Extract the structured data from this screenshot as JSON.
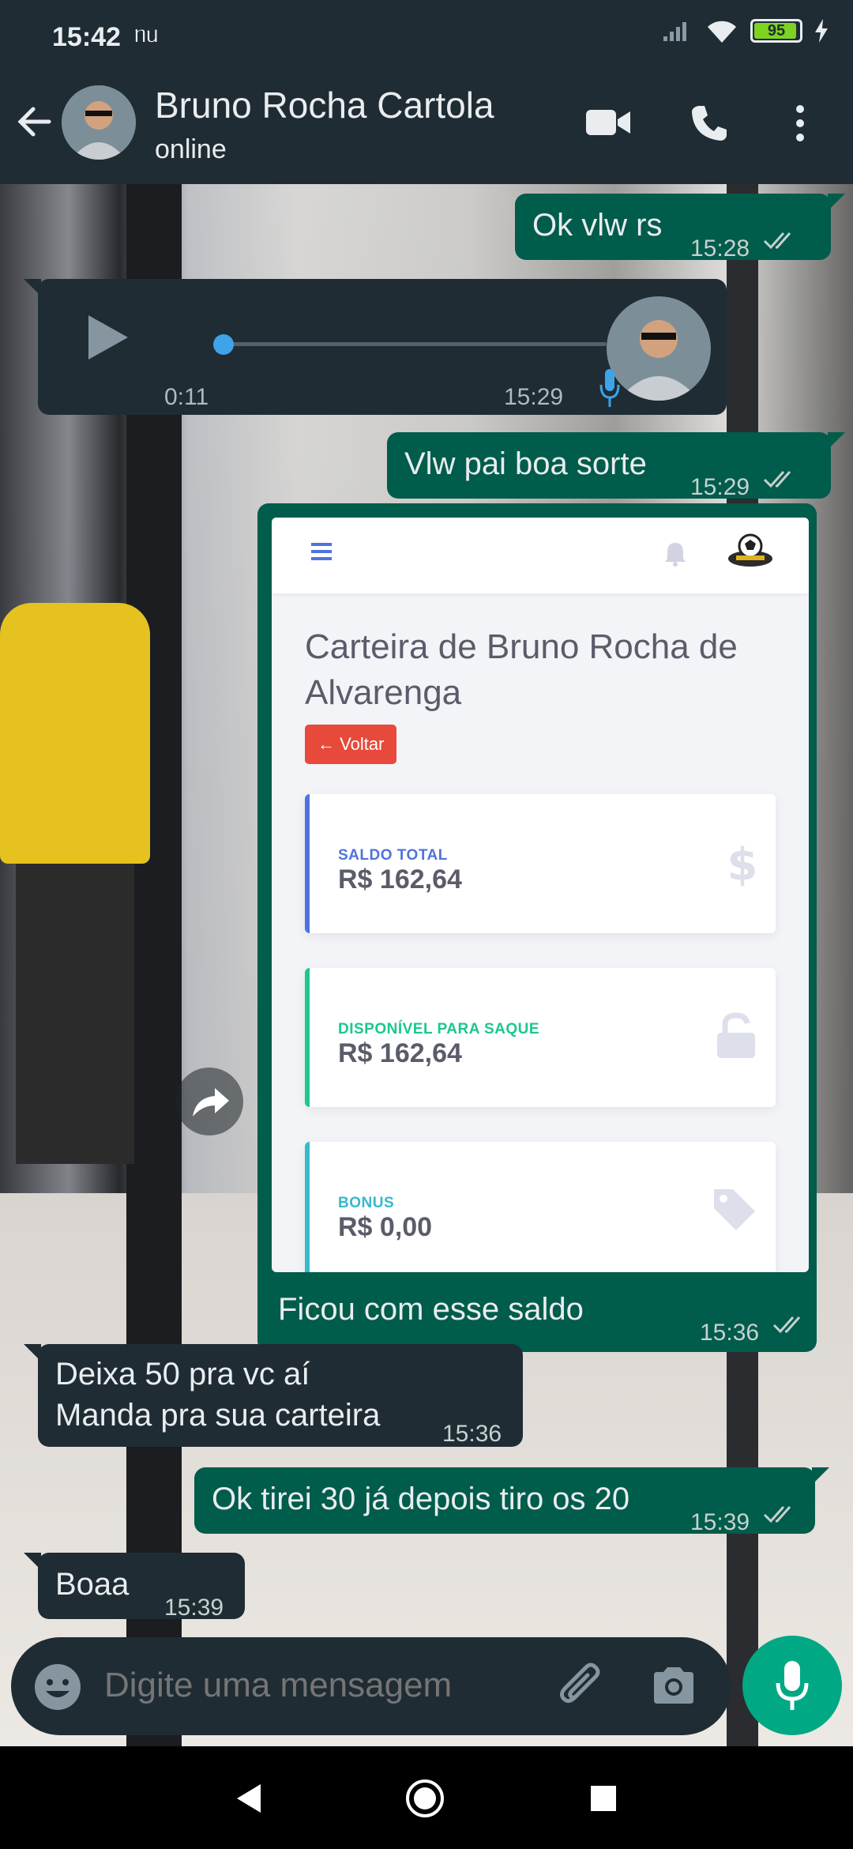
{
  "status_bar": {
    "time": "15:42",
    "extra": "ᥒᥙ",
    "battery": "95"
  },
  "header": {
    "name": "Bruno Rocha Cartola",
    "status": "online"
  },
  "messages": {
    "m1": {
      "text": "Ok vlw rs",
      "time": "15:28"
    },
    "audio": {
      "duration": "0:11",
      "time": "15:29",
      "progress": 0.02
    },
    "m2": {
      "text": "Vlw pai boa sorte",
      "time": "15:29"
    },
    "image_caption": {
      "text": "Ficou com esse saldo",
      "time": "15:36"
    },
    "m3": {
      "line1": "Deixa 50 pra vc aí",
      "line2": "Manda pra sua carteira",
      "time": "15:36"
    },
    "m4": {
      "text": "Ok tirei 30 já depois tiro os 20",
      "time": "15:39"
    },
    "m5": {
      "text": "Boaa",
      "time": "15:39"
    }
  },
  "wallet": {
    "title": "Carteira de Bruno Rocha de Alvarenga",
    "back_label": "Voltar",
    "cards": [
      {
        "label": "SALDO TOTAL",
        "value": "R$ 162,64",
        "color": "#4e73df",
        "icon": "dollar-icon"
      },
      {
        "label": "DISPONÍVEL PARA SAQUE",
        "value": "R$ 162,64",
        "color": "#1cc88a",
        "icon": "unlock-icon"
      },
      {
        "label": "BONUS",
        "value": "R$ 0,00",
        "color": "#36b9cc",
        "icon": "tag-icon"
      }
    ]
  },
  "composer": {
    "placeholder": "Digite uma mensagem"
  },
  "colors": {
    "outgoing": "#005c4b",
    "incoming": "#1f2c34",
    "accent": "#00a884",
    "header": "#1f2c34"
  }
}
